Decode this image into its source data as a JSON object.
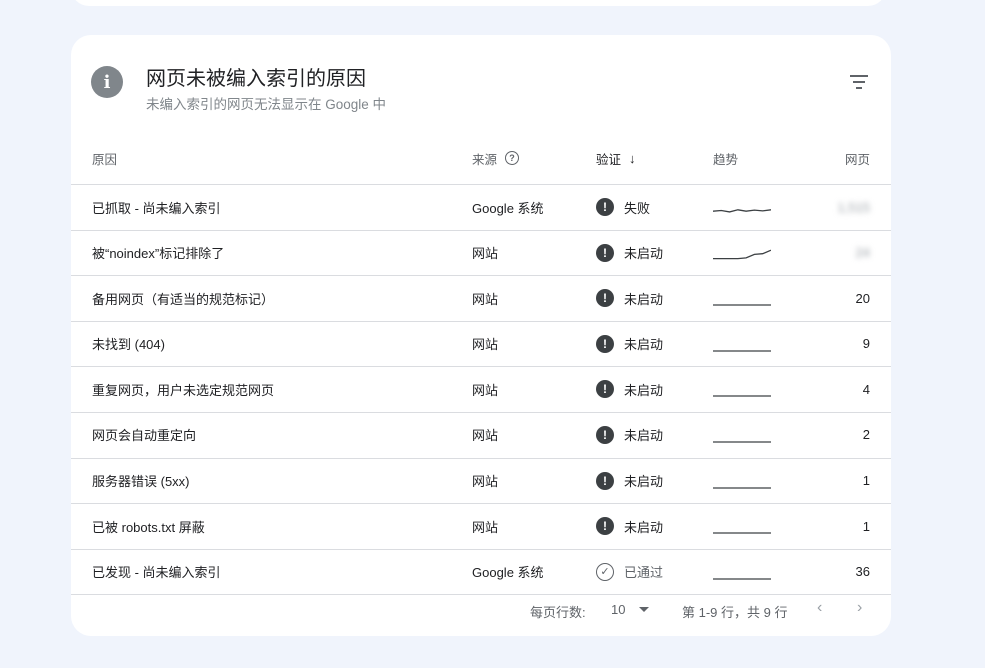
{
  "header": {
    "title": "网页未被编入索引的原因",
    "subtitle": "未编入索引的网页无法显示在 Google 中"
  },
  "columns": {
    "reason": "原因",
    "source": "来源",
    "verify": "验证",
    "trend": "趋势",
    "pages": "网页"
  },
  "rows": [
    {
      "reason": "已抓取 - 尚未编入索引",
      "source": "Google 系统",
      "status": "失败",
      "status_type": "failed",
      "pages": "1,515",
      "pages_blurred": true,
      "trend": [
        0.8,
        0.75,
        0.85,
        0.7,
        0.8,
        0.72,
        0.78,
        0.7
      ],
      "trend_color": "#3c4043"
    },
    {
      "reason": "被“noindex”标记排除了",
      "source": "网站",
      "status": "未启动",
      "status_type": "not-started",
      "pages": "24",
      "pages_blurred": true,
      "trend": [
        0.9,
        0.9,
        0.9,
        0.9,
        0.85,
        0.6,
        0.55,
        0.3
      ],
      "trend_color": "#3c4043"
    },
    {
      "reason": "备用网页（有适当的规范标记）",
      "source": "网站",
      "status": "未启动",
      "status_type": "not-started",
      "pages": "20",
      "pages_blurred": false,
      "trend": [
        1,
        1,
        1,
        1,
        1,
        1,
        1,
        1
      ],
      "trend_color": "#3c4043"
    },
    {
      "reason": "未找到 (404)",
      "source": "网站",
      "status": "未启动",
      "status_type": "not-started",
      "pages": "9",
      "pages_blurred": false,
      "trend": [
        1,
        1,
        1,
        1,
        1,
        1,
        1,
        1
      ],
      "trend_color": "#3c4043"
    },
    {
      "reason": "重复网页，用户未选定规范网页",
      "source": "网站",
      "status": "未启动",
      "status_type": "not-started",
      "pages": "4",
      "pages_blurred": false,
      "trend": [
        1,
        1,
        1,
        1,
        1,
        1,
        1,
        1
      ],
      "trend_color": "#3c4043"
    },
    {
      "reason": "网页会自动重定向",
      "source": "网站",
      "status": "未启动",
      "status_type": "not-started",
      "pages": "2",
      "pages_blurred": false,
      "trend": [
        1,
        1,
        1,
        1,
        1,
        1,
        1,
        1
      ],
      "trend_color": "#3c4043"
    },
    {
      "reason": "服务器错误 (5xx)",
      "source": "网站",
      "status": "未启动",
      "status_type": "not-started",
      "pages": "1",
      "pages_blurred": false,
      "trend": [
        1,
        1,
        1,
        1,
        1,
        1,
        1,
        1
      ],
      "trend_color": "#3c4043"
    },
    {
      "reason": "已被 robots.txt 屏蔽",
      "source": "网站",
      "status": "未启动",
      "status_type": "not-started",
      "pages": "1",
      "pages_blurred": false,
      "trend": [
        1,
        1,
        1,
        1,
        1,
        1,
        1,
        1
      ],
      "trend_color": "#3c4043"
    },
    {
      "reason": "已发现 - 尚未编入索引",
      "source": "Google 系统",
      "status": "已通过",
      "status_type": "passed",
      "pages": "36",
      "pages_blurred": false,
      "trend": [
        1,
        1,
        1,
        1,
        1,
        1,
        1,
        1
      ],
      "trend_color": "#3c4043"
    }
  ],
  "footer": {
    "rows_per_page_label": "每页行数:",
    "rows_per_page_value": "10",
    "range_text": "第 1-9 行，共 9 行"
  },
  "icons": {
    "info": "info-icon",
    "filter": "filter-icon",
    "help": "help-circle-icon",
    "sort": "arrow-down-icon",
    "failed": "exclamation-circle-icon",
    "passed": "check-circle-icon",
    "prev": "chevron-left-icon",
    "next": "chevron-right-icon"
  }
}
